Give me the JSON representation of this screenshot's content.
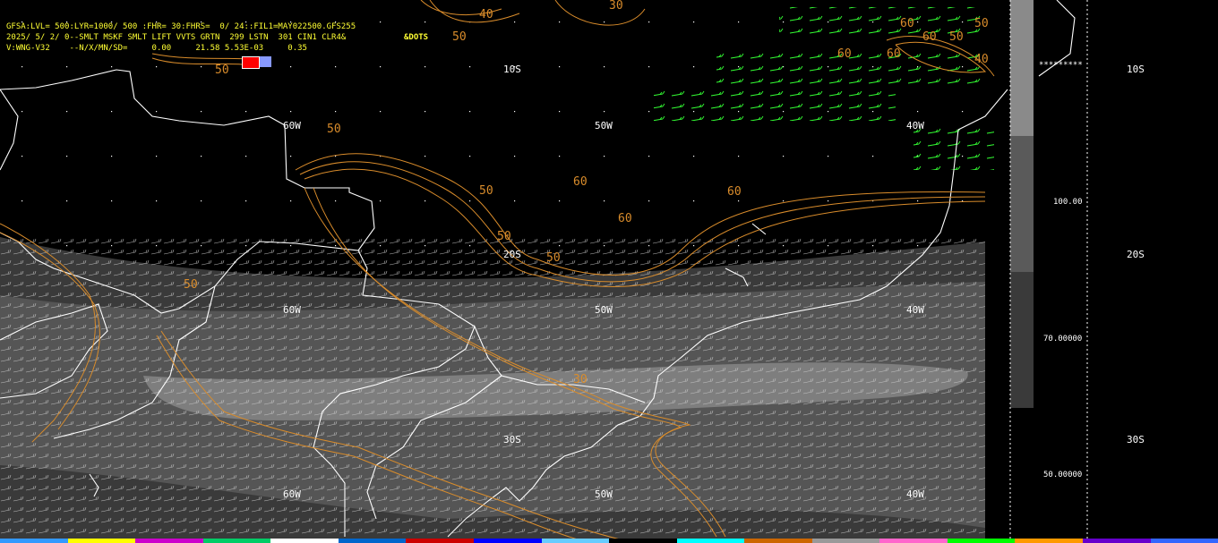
{
  "header": {
    "line1": "GFSA:LVL= 500:LYR=1000/ 500 :FHR= 30:FHRS=  0/ 24::FIL1=MAY022500.GFS255",
    "line2": "2025/ 5/ 2/ 0--SMLT MSKF SMLT LIFT VVTS GRTN  299 LSTN  301 CIN1 CLR4&",
    "line3": "V:WNG-V32    --N/X/MN/SD=     0.00     21.58 5.53E-03     0.35",
    "dots_label": "&DOTS"
  },
  "grid_labels": {
    "lon_60w": "60W",
    "lon_50w": "50W",
    "lon_40w": "40W",
    "lat_10s": "10S",
    "lat_20s": "20S",
    "lat_30s": "30S"
  },
  "contour_labels": [
    "50",
    "40",
    "50",
    "30",
    "50",
    "50",
    "60",
    "50",
    "60",
    "60",
    "60",
    "50",
    "60",
    "60",
    "50",
    "60",
    "50",
    "40",
    "30",
    "50"
  ],
  "colorbar": {
    "labels": [
      "100.00",
      "70.00000",
      "50.00000"
    ],
    "stars": "*********"
  },
  "right_panel": {
    "lat_labels": [
      "10S",
      "20S",
      "30S"
    ]
  },
  "colors": {
    "background": "#000000",
    "header_text": "#ffff33",
    "contour": "#d98c2b",
    "coastline": "#ffffff",
    "wind_barbs": "#33ff33",
    "shade_dark": "#3a3a3a",
    "shade_mid": "#5a5a5a",
    "shade_light": "#8a8a8a"
  }
}
